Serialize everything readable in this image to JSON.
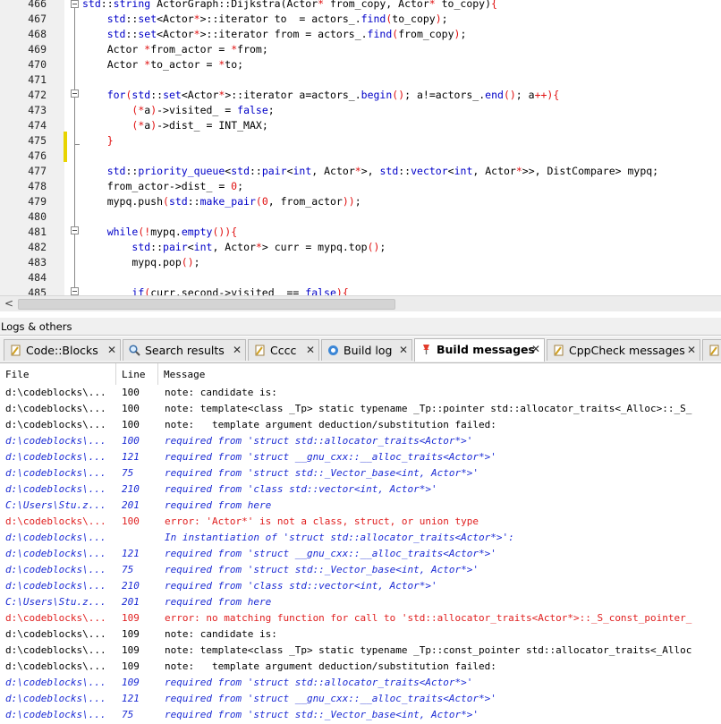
{
  "editor": {
    "lines": [
      {
        "num": "466",
        "code": "<span class='k'>std</span>::<span class='k'>string</span> ActorGraph::Dijkstra(Actor<span class='r'>*</span> from_copy, Actor<span class='r'>*</span> to_copy)<span class='r'>{</span>"
      },
      {
        "num": "467",
        "code": "    <span class='k'>std</span>::<span class='k'>set</span>&lt;Actor<span class='r'>*</span>&gt;::iterator to  = actors_.<span class='k'>find</span><span class='r'>(</span>to_copy<span class='r'>)</span>;"
      },
      {
        "num": "468",
        "code": "    <span class='k'>std</span>::<span class='k'>set</span>&lt;Actor<span class='r'>*</span>&gt;::iterator from = actors_.<span class='k'>find</span><span class='r'>(</span>from_copy<span class='r'>)</span>;"
      },
      {
        "num": "469",
        "code": "    Actor <span class='r'>*</span>from_actor = <span class='r'>*</span>from;"
      },
      {
        "num": "470",
        "code": "    Actor <span class='r'>*</span>to_actor = <span class='r'>*</span>to;"
      },
      {
        "num": "471",
        "code": ""
      },
      {
        "num": "472",
        "code": "    <span class='k'>for</span><span class='r'>(</span><span class='k'>std</span>::<span class='k'>set</span>&lt;Actor<span class='r'>*</span>&gt;::iterator a=actors_.<span class='k'>begin</span><span class='r'>()</span>; a!=actors_.<span class='k'>end</span><span class='r'>()</span>; a<span class='r'>++)</span><span class='r'>{</span>"
      },
      {
        "num": "473",
        "code": "        <span class='r'>(*</span>a<span class='r'>)</span>-&gt;visited_ = <span class='k'>false</span>;"
      },
      {
        "num": "474",
        "code": "        <span class='r'>(*</span>a<span class='r'>)</span>-&gt;dist_ = INT_MAX;"
      },
      {
        "num": "475",
        "code": "    <span class='r'>}</span>"
      },
      {
        "num": "476",
        "code": ""
      },
      {
        "num": "477",
        "code": "    <span class='k'>std</span>::<span class='k'>priority_queue</span>&lt;<span class='k'>std</span>::<span class='k'>pair</span>&lt;<span class='k'>int</span>, Actor<span class='r'>*</span>&gt;, <span class='k'>std</span>::<span class='k'>vector</span>&lt;<span class='k'>int</span>, Actor<span class='r'>*</span>&gt;&gt;, DistCompare&gt; mypq;"
      },
      {
        "num": "478",
        "code": "    from_actor-&gt;dist_ = <span class='r'>0</span>;"
      },
      {
        "num": "479",
        "code": "    mypq.push<span class='r'>(</span><span class='k'>std</span>::<span class='k'>make_pair</span><span class='r'>(0</span>, from_actor<span class='r'>))</span>;"
      },
      {
        "num": "480",
        "code": ""
      },
      {
        "num": "481",
        "code": "    <span class='k'>while</span><span class='r'>(!</span>mypq.<span class='k'>empty</span><span class='r'>())</span><span class='r'>{</span>"
      },
      {
        "num": "482",
        "code": "        <span class='k'>std</span>::<span class='k'>pair</span>&lt;<span class='k'>int</span>, Actor<span class='r'>*</span>&gt; curr = mypq.top<span class='r'>()</span>;"
      },
      {
        "num": "483",
        "code": "        mypq.pop<span class='r'>()</span>;"
      },
      {
        "num": "484",
        "code": ""
      },
      {
        "num": "485",
        "code": "        <span class='k'>if</span><span class='r'>(</span>curr.second-&gt;visited_ == <span class='k'>false</span><span class='r'>)</span><span class='r'>{</span>"
      }
    ]
  },
  "panel": {
    "title": "Logs & others"
  },
  "tabs": [
    {
      "label": "Code::Blocks",
      "icon": "page-icon",
      "active": false
    },
    {
      "label": "Search results",
      "icon": "search-icon",
      "active": false
    },
    {
      "label": "Cccc",
      "icon": "page-icon",
      "active": false
    },
    {
      "label": "Build log",
      "icon": "gear-icon",
      "active": false
    },
    {
      "label": "Build messages",
      "icon": "pin-icon",
      "active": true
    },
    {
      "label": "CppCheck messages",
      "icon": "page-icon",
      "active": false
    }
  ],
  "close_glyph": "✕",
  "table": {
    "headers": [
      "File",
      "Line",
      "Message"
    ],
    "rows": [
      {
        "file": "d:\\codeblocks\\...",
        "line": "100",
        "msg": "note: candidate is:",
        "type": "note"
      },
      {
        "file": "d:\\codeblocks\\...",
        "line": "100",
        "msg": "note: template<class _Tp> static typename _Tp::pointer std::allocator_traits<_Alloc>::_S_",
        "type": "note"
      },
      {
        "file": "d:\\codeblocks\\...",
        "line": "100",
        "msg": "note:   template argument deduction/substitution failed:",
        "type": "note"
      },
      {
        "file": "d:\\codeblocks\\...",
        "line": "100",
        "msg": "required from 'struct std::allocator_traits<Actor*>'",
        "type": "req"
      },
      {
        "file": "d:\\codeblocks\\...",
        "line": "121",
        "msg": "required from 'struct __gnu_cxx::__alloc_traits<Actor*>'",
        "type": "req"
      },
      {
        "file": "d:\\codeblocks\\...",
        "line": "75",
        "msg": "required from 'struct std::_Vector_base<int, Actor*>'",
        "type": "req"
      },
      {
        "file": "d:\\codeblocks\\...",
        "line": "210",
        "msg": "required from 'class std::vector<int, Actor*>'",
        "type": "req"
      },
      {
        "file": "C:\\Users\\Stu.z...",
        "line": "201",
        "msg": "required from here",
        "type": "req"
      },
      {
        "file": "d:\\codeblocks\\...",
        "line": "100",
        "msg": "error: 'Actor*' is not a class, struct, or union type",
        "type": "err"
      },
      {
        "file": "d:\\codeblocks\\...",
        "line": "",
        "msg": "In instantiation of 'struct std::allocator_traits<Actor*>':",
        "type": "req"
      },
      {
        "file": "d:\\codeblocks\\...",
        "line": "121",
        "msg": "required from 'struct __gnu_cxx::__alloc_traits<Actor*>'",
        "type": "req"
      },
      {
        "file": "d:\\codeblocks\\...",
        "line": "75",
        "msg": "required from 'struct std::_Vector_base<int, Actor*>'",
        "type": "req"
      },
      {
        "file": "d:\\codeblocks\\...",
        "line": "210",
        "msg": "required from 'class std::vector<int, Actor*>'",
        "type": "req"
      },
      {
        "file": "C:\\Users\\Stu.z...",
        "line": "201",
        "msg": "required from here",
        "type": "req"
      },
      {
        "file": "d:\\codeblocks\\...",
        "line": "109",
        "msg": "error: no matching function for call to 'std::allocator_traits<Actor*>::_S_const_pointer_",
        "type": "err"
      },
      {
        "file": "d:\\codeblocks\\...",
        "line": "109",
        "msg": "note: candidate is:",
        "type": "note"
      },
      {
        "file": "d:\\codeblocks\\...",
        "line": "109",
        "msg": "note: template<class _Tp> static typename _Tp::const_pointer std::allocator_traits<_Alloc",
        "type": "note"
      },
      {
        "file": "d:\\codeblocks\\...",
        "line": "109",
        "msg": "note:   template argument deduction/substitution failed:",
        "type": "note"
      },
      {
        "file": "d:\\codeblocks\\...",
        "line": "109",
        "msg": "required from 'struct std::allocator_traits<Actor*>'",
        "type": "req"
      },
      {
        "file": "d:\\codeblocks\\...",
        "line": "121",
        "msg": "required from 'struct __gnu_cxx::__alloc_traits<Actor*>'",
        "type": "req"
      },
      {
        "file": "d:\\codeblocks\\...",
        "line": "75",
        "msg": "required from 'struct std::_Vector_base<int, Actor*>'",
        "type": "req"
      }
    ]
  },
  "colors": {
    "keyword": "#0000c8",
    "operator": "#e01010",
    "error": "#e02020",
    "required": "#1c2cd4",
    "changed_marker": "#e8d400"
  }
}
